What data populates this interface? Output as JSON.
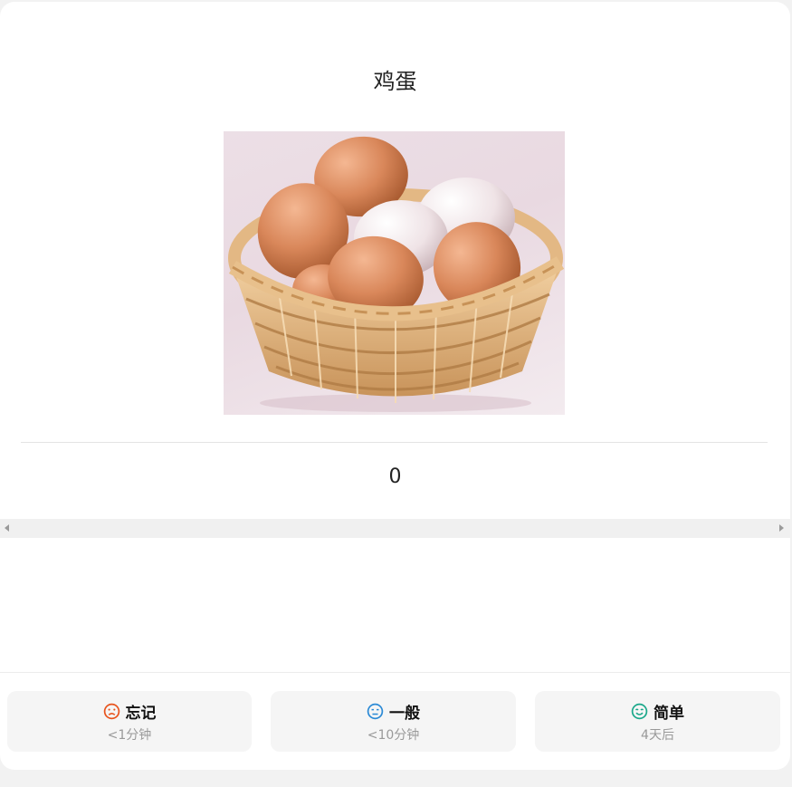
{
  "card": {
    "word": "鸡蛋",
    "image_alt": "鸡蛋",
    "answer": "0"
  },
  "buttons": [
    {
      "label": "忘记",
      "interval": "<1分钟",
      "icon": "sad-face-icon",
      "color": "#e8531c"
    },
    {
      "label": "一般",
      "interval": "<10分钟",
      "icon": "neutral-face-icon",
      "color": "#2b8ad6"
    },
    {
      "label": "简单",
      "interval": "4天后",
      "icon": "smile-face-icon",
      "color": "#1aa88a"
    }
  ]
}
